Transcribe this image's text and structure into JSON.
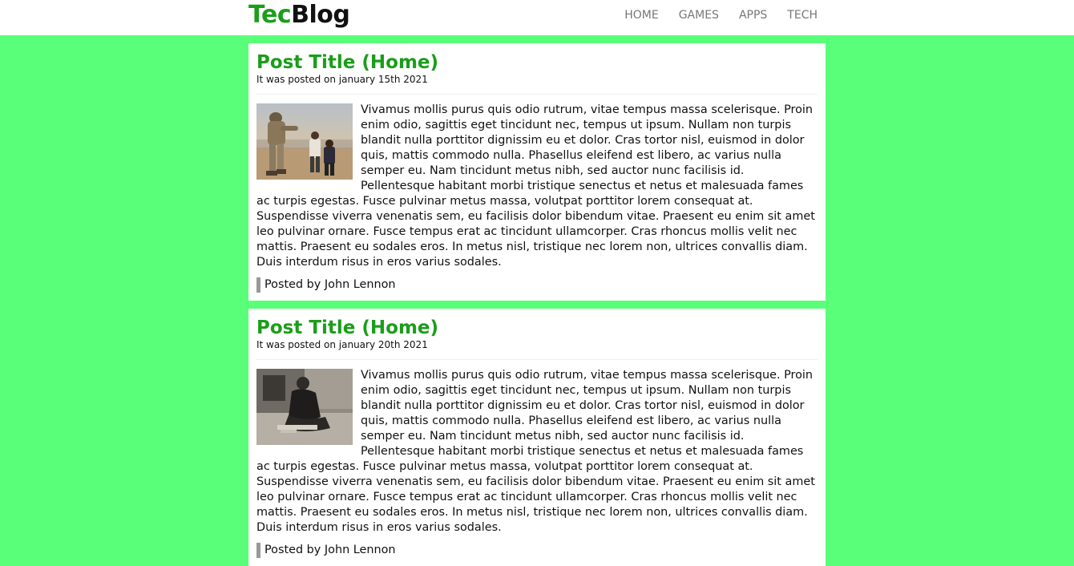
{
  "brand": {
    "part1": "Tec",
    "part2": "Blog",
    "accent_color": "#1a9e1a"
  },
  "nav": {
    "items": [
      {
        "label": "HOME"
      },
      {
        "label": "GAMES"
      },
      {
        "label": "APPS"
      },
      {
        "label": "TECH"
      }
    ]
  },
  "page": {
    "background": "#59ff78"
  },
  "posts": [
    {
      "title": "Post Title (Home)",
      "date": "It was posted on january 15th 2021",
      "image": "soldier-with-children-photo",
      "body": "Vivamus mollis purus quis odio rutrum, vitae tempus massa scelerisque. Proin enim odio, sagittis eget tincidunt nec, tempus ut ipsum. Nullam non turpis blandit nulla porttitor dignissim eu et dolor. Cras tortor nisl, euismod in dolor quis, mattis commodo nulla. Phasellus eleifend est libero, ac varius nulla semper eu. Nam tincidunt metus nibh, sed auctor nunc facilisis id. Pellentesque habitant morbi tristique senectus et netus et malesuada fames ac turpis egestas. Fusce pulvinar metus massa, volutpat porttitor lorem consequat at. Suspendisse viverra venenatis sem, eu facilisis dolor bibendum vitae. Praesent eu enim sit amet leo pulvinar ornare. Fusce tempus erat ac tincidunt ullamcorper. Cras rhoncus mollis velit nec mattis. Praesent eu sodales eros. In metus nisl, tristique nec lorem non, ultrices convallis diam. Duis interdum risus in eros varius sodales.",
      "author": "Posted by John Lennon"
    },
    {
      "title": "Post Title (Home)",
      "date": "It was posted on january 20th 2021",
      "image": "man-sitting-black-and-white-photo",
      "body": "Vivamus mollis purus quis odio rutrum, vitae tempus massa scelerisque. Proin enim odio, sagittis eget tincidunt nec, tempus ut ipsum. Nullam non turpis blandit nulla porttitor dignissim eu et dolor. Cras tortor nisl, euismod in dolor quis, mattis commodo nulla. Phasellus eleifend est libero, ac varius nulla semper eu. Nam tincidunt metus nibh, sed auctor nunc facilisis id. Pellentesque habitant morbi tristique senectus et netus et malesuada fames ac turpis egestas. Fusce pulvinar metus massa, volutpat porttitor lorem consequat at. Suspendisse viverra venenatis sem, eu facilisis dolor bibendum vitae. Praesent eu enim sit amet leo pulvinar ornare. Fusce tempus erat ac tincidunt ullamcorper. Cras rhoncus mollis velit nec mattis. Praesent eu sodales eros. In metus nisl, tristique nec lorem non, ultrices convallis diam. Duis interdum risus in eros varius sodales.",
      "author": "Posted by John Lennon"
    }
  ]
}
